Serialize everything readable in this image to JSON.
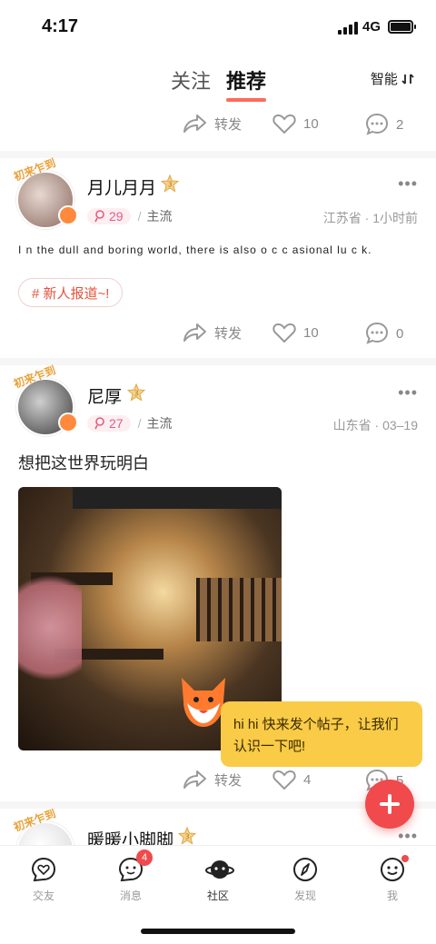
{
  "status_bar": {
    "time": "4:17",
    "network": "4G"
  },
  "header": {
    "tabs": [
      {
        "label": "关注"
      },
      {
        "label": "推荐"
      }
    ],
    "sort_label": "智能"
  },
  "top_actions": {
    "share": "转发",
    "likes": "10",
    "comments": "2"
  },
  "posts": [
    {
      "avatar_frame_text": "初来乍到",
      "name": "月儿月月",
      "level": "3",
      "badge_count": "29",
      "category": "主流",
      "location_time": "江苏省 · 1小时前",
      "text": "I n the dull and boring world, there is also o c c asional lu c k.",
      "tag": "# 新人报道~!",
      "share": "转发",
      "likes": "10",
      "comments": "0"
    },
    {
      "avatar_frame_text": "初来乍到",
      "name": "尼厚",
      "level": "3",
      "badge_count": "27",
      "category": "主流",
      "location_time": "山东省 · 03–19",
      "text": "想把这世界玩明白",
      "share": "转发",
      "likes": "4",
      "comments": "5"
    },
    {
      "avatar_frame_text": "初来乍到",
      "name": "暖暖小脚脚",
      "level": "3"
    }
  ],
  "bubble_text": "hi hi 快来发个帖子，让我们认识一下吧!",
  "tabbar": {
    "items": [
      {
        "label": "交友",
        "icon": "heart-chat-icon"
      },
      {
        "label": "消息",
        "icon": "message-icon",
        "count": "4"
      },
      {
        "label": "社区",
        "icon": "planet-icon"
      },
      {
        "label": "发现",
        "icon": "compass-icon"
      },
      {
        "label": "我",
        "icon": "smile-icon"
      }
    ]
  },
  "colors": {
    "accent": "#f04a4c",
    "underline": "#ff6a5a",
    "bubble": "#f9cb46",
    "tag_text": "#e5533d"
  }
}
